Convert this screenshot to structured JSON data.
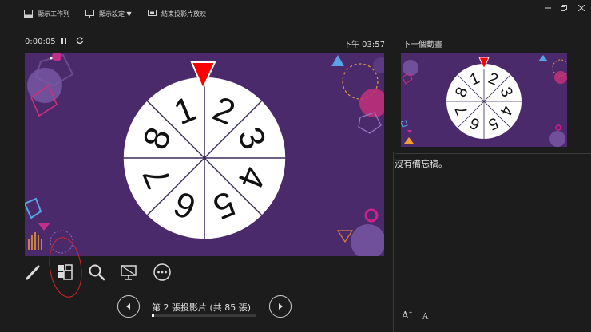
{
  "toolbar": {
    "show_taskbar": "顯示工作列",
    "display_settings": "顯示設定 ▼",
    "end_show": "結束投影片放映"
  },
  "presenter": {
    "elapsed": "0:00:05",
    "pause_icon": "pause-icon",
    "restart_icon": "restart-icon",
    "clock": "下午 03:57",
    "next_animation_title": "下一個動畫",
    "notes": "沒有備忘稿。"
  },
  "slide": {
    "wheel_numbers": [
      "1",
      "2",
      "3",
      "4",
      "5",
      "6",
      "7",
      "8"
    ],
    "pointer_color": "#ff0000",
    "background_color": "#4b2a6b"
  },
  "tools": [
    "pen-icon",
    "all-slides-icon",
    "zoom-icon",
    "black-screen-icon",
    "more-options-icon"
  ],
  "nav": {
    "counter": "第 2 張投影片 (共 85 張)",
    "current": 2,
    "total": 85
  },
  "font_controls": {
    "increase": "A",
    "decrease": "A"
  }
}
